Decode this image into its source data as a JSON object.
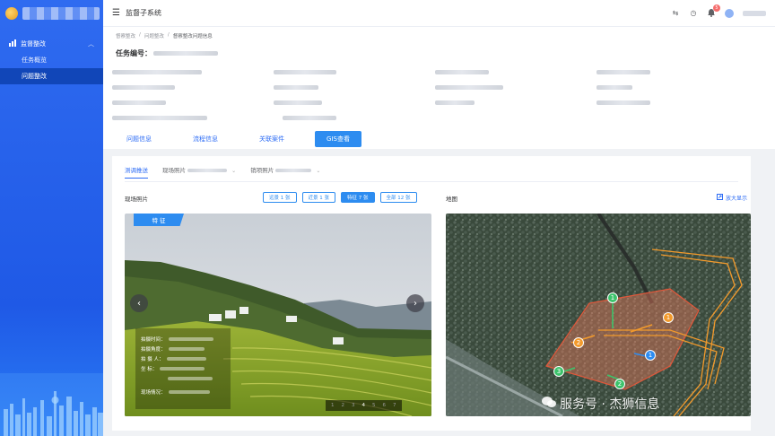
{
  "app": {
    "system_title": "监督子系统"
  },
  "sidebar": {
    "group_label": "监督整改",
    "items": [
      {
        "label": "任务概览",
        "active": false
      },
      {
        "label": "问题整改",
        "active": true
      }
    ],
    "icons": {
      "group": "chart-icon",
      "chevron": "chevron-up-icon"
    }
  },
  "topbar": {
    "menu_icon": "menu-icon",
    "icons": [
      "sync-icon",
      "clock-icon",
      "bell-icon"
    ],
    "notification_count": "5"
  },
  "breadcrumb": [
    "督察整改",
    "问题整改",
    "督察整改问题信息"
  ],
  "task": {
    "label": "任务编号："
  },
  "tabs": [
    {
      "label": "问题信息",
      "active": false
    },
    {
      "label": "流程信息",
      "active": false
    },
    {
      "label": "关联案件",
      "active": false
    },
    {
      "label": "GIS查看",
      "active": true
    }
  ],
  "subtabs": [
    {
      "label": "测调推送",
      "active": true
    },
    {
      "label": "现场照片",
      "active": false
    },
    {
      "label": "销项照片",
      "active": false
    }
  ],
  "photos": {
    "section_label": "现场照片",
    "filters": [
      {
        "label": "远景 1 张",
        "active": false
      },
      {
        "label": "近景 1 张",
        "active": false
      },
      {
        "label": "特征 7 张",
        "active": true
      },
      {
        "label": "全部 12 张",
        "active": false
      }
    ],
    "tag": "特  征",
    "info_labels": [
      "拍摄时间：",
      "拍摄角度：",
      "拍 摄 人：",
      "坐    标：",
      "现场情况："
    ],
    "pager": [
      "1",
      "2",
      "3",
      "4",
      "5",
      "6",
      "7"
    ],
    "current_page": "4"
  },
  "map": {
    "section_label": "地图",
    "zoom_label": "放大显示",
    "markers": [
      {
        "label": "1",
        "color": "#3cc36b"
      },
      {
        "label": "1",
        "color": "#f39a2b"
      },
      {
        "label": "1",
        "color": "#2d8cf0"
      },
      {
        "label": "2",
        "color": "#f39a2b"
      },
      {
        "label": "2",
        "color": "#3cc36b"
      },
      {
        "label": "3",
        "color": "#3cc36b"
      }
    ]
  },
  "watermark": "服务号 · 杰狮信息",
  "colors": {
    "primary": "#2d8cf0",
    "sidebar": "#1f59e6",
    "danger": "#f56c6c"
  }
}
